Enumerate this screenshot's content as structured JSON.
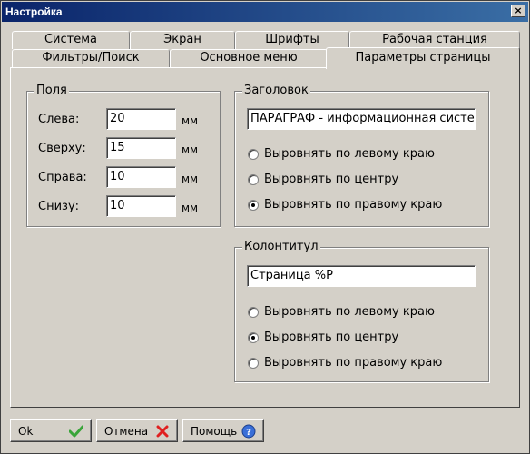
{
  "window": {
    "title": "Настройка",
    "close_symbol": "×"
  },
  "tabs": {
    "row1": [
      "Система",
      "Экран",
      "Шрифты",
      "Рабочая станция"
    ],
    "row2": [
      "Фильтры/Поиск",
      "Основное меню",
      "Параметры страницы"
    ],
    "active": "Параметры страницы"
  },
  "margins": {
    "legend": "Поля",
    "unit": "мм",
    "fields": [
      {
        "label": "Слева:",
        "value": "20"
      },
      {
        "label": "Сверху:",
        "value": "15"
      },
      {
        "label": "Справа:",
        "value": "10"
      },
      {
        "label": "Снизу:",
        "value": "10"
      }
    ]
  },
  "header": {
    "legend": "Заголовок",
    "text": "ПАРАГРАФ - информационная систе",
    "options": [
      "Выровнять по левому краю",
      "Выровнять по центру",
      "Выровнять по правому краю"
    ],
    "selected_index": 2
  },
  "footer": {
    "legend": "Колонтитул",
    "text": "Страница %P",
    "options": [
      "Выровнять по левому краю",
      "Выровнять по центру",
      "Выровнять по правому краю"
    ],
    "selected_index": 1
  },
  "buttons": {
    "ok": {
      "label": "Ok",
      "icon": "check-icon",
      "color": "#3aa53a"
    },
    "cancel": {
      "label": "Отмена",
      "icon": "cross-icon",
      "color": "#e02020"
    },
    "help": {
      "label": "Помощь",
      "icon": "help-icon",
      "color": "#3a6fd8"
    }
  }
}
